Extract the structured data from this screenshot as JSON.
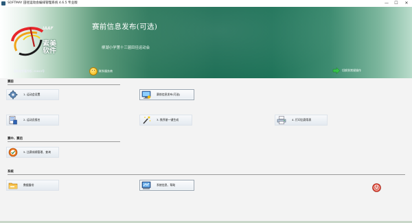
{
  "window": {
    "title": "SOFTMAY 田径运动会编排管理系统 4.6.5 专业版",
    "minimize": "—",
    "maximize": "☐",
    "close": "✕"
  },
  "banner": {
    "title": "赛前信息发布(可选)",
    "subtitle": "柳湖小学第十三届田径运动会",
    "logo_text": "索美\n软件",
    "logo_badge": "IAAF",
    "meta": "国防软件著作权: 01645号",
    "link_left": "联系服务商",
    "link_right": "切换到常规操作"
  },
  "sections": {
    "prep": "赛前",
    "during": "赛中、赛后",
    "system": "系统"
  },
  "buttons": {
    "meet_settings": "1. 运动会设置",
    "pre_info": "赛前信息发布(可选)",
    "entry": "2. 运动员报名",
    "arrange": "3. 秩序册一键生成",
    "print": "4. 打印比赛用表",
    "results": "5. 比赛成绩管理、查询",
    "backup": "数据备份",
    "sysinfo": "系统信息、帮助"
  },
  "icons": {
    "meet_settings": "gear-icon",
    "pre_info": "monitor-info-icon",
    "entry": "entry-form-icon",
    "arrange": "magic-wand-icon",
    "print": "printer-icon",
    "results": "results-icon",
    "backup": "backup-folder-icon",
    "sysinfo": "system-info-icon",
    "exit": "power-icon"
  }
}
